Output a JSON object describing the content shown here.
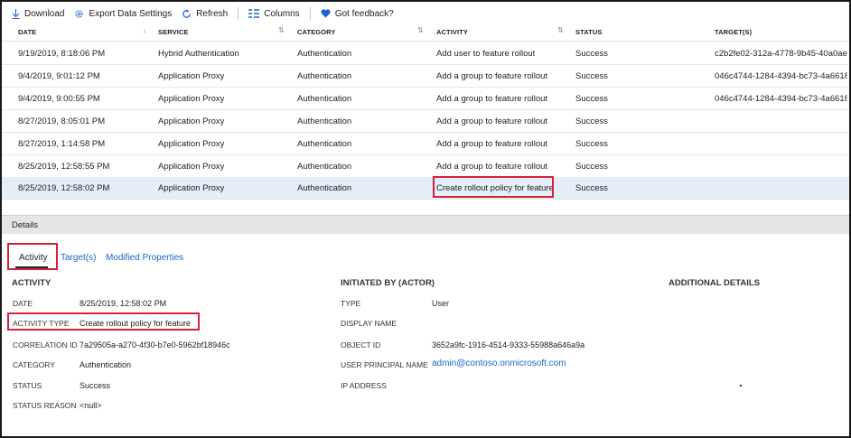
{
  "toolbar": {
    "download": "Download",
    "export": "Export Data Settings",
    "refresh": "Refresh",
    "columns": "Columns",
    "feedback": "Got feedback?"
  },
  "table": {
    "headers": {
      "date": "DATE",
      "service": "SERVICE",
      "category": "CATEGORY",
      "activity": "ACTIVITY",
      "status": "STATUS",
      "target": "TARGET(S)"
    },
    "rows": [
      {
        "date": "9/19/2019, 8:18:06 PM",
        "service": "Hybrid Authentication",
        "category": "Authentication",
        "activity": "Add user to feature rollout",
        "status": "Success",
        "target": "c2b2fe02-312a-4778-9b45-40a0ae..."
      },
      {
        "date": "9/4/2019, 9:01:12 PM",
        "service": "Application Proxy",
        "category": "Authentication",
        "activity": "Add a group to feature rollout",
        "status": "Success",
        "target": "046c4744-1284-4394-bc73-4a6618..."
      },
      {
        "date": "9/4/2019, 9:00:55 PM",
        "service": "Application Proxy",
        "category": "Authentication",
        "activity": "Add a group to feature rollout",
        "status": "Success",
        "target": "046c4744-1284-4394-bc73-4a6618..."
      },
      {
        "date": "8/27/2019, 8:05:01 PM",
        "service": "Application Proxy",
        "category": "Authentication",
        "activity": "Add a group to feature rollout",
        "status": "Success",
        "target": ""
      },
      {
        "date": "8/27/2019, 1:14:58 PM",
        "service": "Application Proxy",
        "category": "Authentication",
        "activity": "Add a group to feature rollout",
        "status": "Success",
        "target": ""
      },
      {
        "date": "8/25/2019, 12:58:55 PM",
        "service": "Application Proxy",
        "category": "Authentication",
        "activity": "Add a group to feature rollout",
        "status": "Success",
        "target": ""
      },
      {
        "date": "8/25/2019, 12:58:02 PM",
        "service": "Application Proxy",
        "category": "Authentication",
        "activity": "Create rollout policy for feature",
        "status": "Success",
        "target": ""
      }
    ]
  },
  "details": {
    "bar_label": "Details",
    "tabs": {
      "activity": "Activity",
      "targets": "Target(s)",
      "modified": "Modified Properties"
    },
    "activity": {
      "title": "ACTIVITY",
      "date_key": "DATE",
      "date_val": "8/25/2019, 12:58:02 PM",
      "type_key": "ACTIVITY TYPE",
      "type_val": "Create rollout policy for feature",
      "corr_key": "CORRELATION ID",
      "corr_val": "7a29505a-a270-4f30-b7e0-5962bf18946c",
      "cat_key": "CATEGORY",
      "cat_val": "Authentication",
      "status_key": "STATUS",
      "status_val": "Success",
      "reason_key": "STATUS REASON",
      "reason_val": "<null>"
    },
    "initiated": {
      "title": "INITIATED BY (ACTOR)",
      "type_key": "TYPE",
      "type_val": "User",
      "display_key": "DISPLAY NAME",
      "object_key": "OBJECT ID",
      "object_val": "3652a9fc-1916-4514-9333-55988a646a9a",
      "upn_key": "USER PRINCIPAL NAME",
      "upn_val": "admin@contoso.onmicrosoft.com",
      "ip_key": "IP ADDRESS"
    },
    "additional": {
      "title": "ADDITIONAL DETAILS"
    }
  },
  "colors": {
    "accent": "#1b66c9",
    "highlight": "#d8203a",
    "selected_row": "#e3eef9"
  }
}
